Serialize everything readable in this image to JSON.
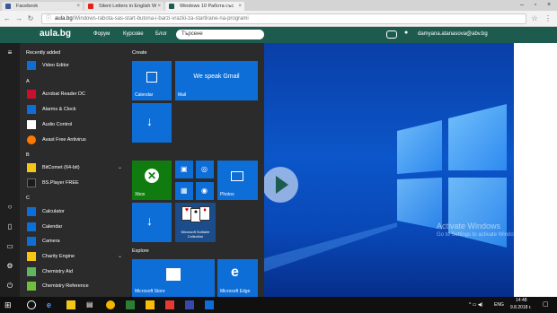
{
  "browser": {
    "tabs": [
      {
        "label": "Facebook"
      },
      {
        "label": "Silent Letters in English W"
      },
      {
        "label": "Windows 10 Работа със"
      }
    ],
    "url_domain": "aula.bg",
    "url_path": "/Windows-rabota-sas-start-butona-i-barzi-vrazki-za-startirane-na-programi"
  },
  "site": {
    "logo": "aula.bg",
    "nav": [
      "Форум",
      "Курсове",
      "Блог"
    ],
    "search_placeholder": "Търсене",
    "user": "damyana.atanasova@abv.bg"
  },
  "start_menu": {
    "recently_added_label": "Recently added",
    "recent_apps": [
      {
        "label": "Video Editor",
        "icon": "video-editor-icon",
        "color": "#0e6ed8"
      }
    ],
    "groups": [
      {
        "letter": "A",
        "apps": [
          {
            "label": "Acrobat Reader DC",
            "icon": "acrobat-icon",
            "color": "#c8102e"
          },
          {
            "label": "Alarms & Clock",
            "icon": "alarm-clock-icon",
            "color": "#0e6ed8"
          },
          {
            "label": "Audio Control",
            "icon": "audio-icon",
            "color": "#ffffff"
          },
          {
            "label": "Avast Free Antivirus",
            "icon": "avast-icon",
            "color": "#ff7800"
          }
        ]
      },
      {
        "letter": "B",
        "apps": [
          {
            "label": "BitComet (64-bit)",
            "icon": "folder-icon",
            "color": "#f5c518"
          },
          {
            "label": "BS.Player FREE",
            "icon": "bsplayer-icon",
            "color": "#1b1b1b"
          }
        ]
      },
      {
        "letter": "C",
        "apps": [
          {
            "label": "Calculator",
            "icon": "calculator-icon",
            "color": "#0e6ed8"
          },
          {
            "label": "Calendar",
            "icon": "calendar-icon",
            "color": "#0e6ed8"
          },
          {
            "label": "Camera",
            "icon": "camera-icon",
            "color": "#0e6ed8"
          },
          {
            "label": "Charity Engine",
            "icon": "folder-icon",
            "color": "#f5c518"
          },
          {
            "label": "Chemistry Aid",
            "icon": "chemistry-icon",
            "color": "#5cb85c"
          },
          {
            "label": "Chemistry Reference",
            "icon": "chemistry-ref-icon",
            "color": "#6fbf3a"
          }
        ]
      }
    ],
    "create_label": "Create",
    "explore_label": "Explore",
    "tiles": {
      "calendar": "Calendar",
      "mail_headline": "We speak Gmail",
      "mail": "Mail",
      "xbox": "Xbox",
      "photos": "Photos",
      "solitaire": "Microsoft Solitaire Collection",
      "store": "Microsoft Store",
      "edge": "Microsoft Edge"
    }
  },
  "desktop": {
    "activate_title": "Activate Windows",
    "activate_sub": "Go to Settings to activate Windows."
  },
  "taskbar": {
    "lang": "ENG",
    "time": "14:48",
    "date": "9.8.2018 г."
  }
}
